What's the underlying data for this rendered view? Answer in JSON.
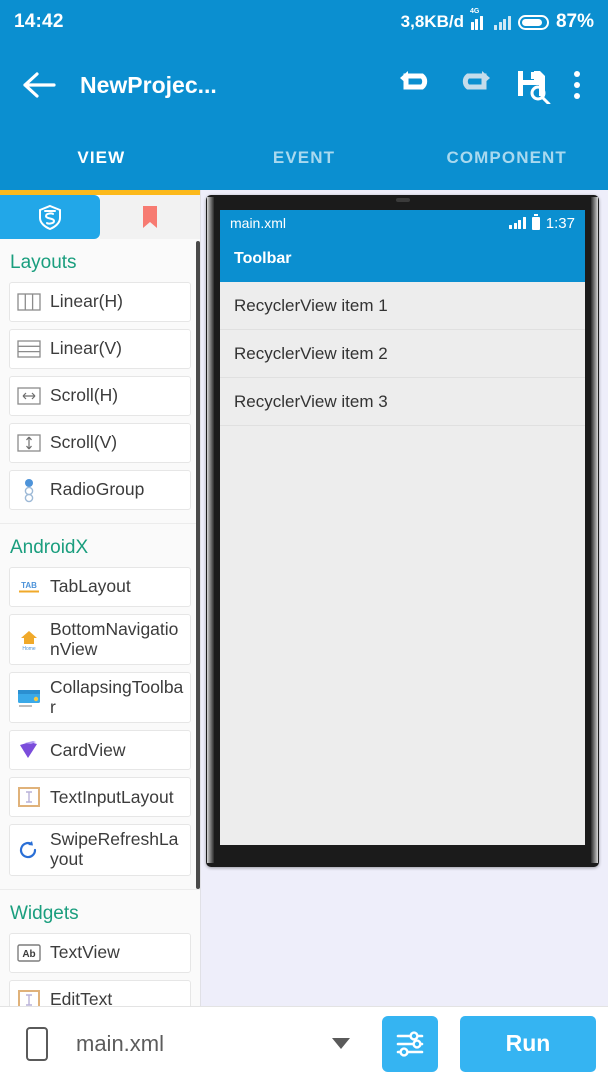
{
  "statusbar": {
    "clock": "14:42",
    "network_speed": "3,8KB/d",
    "network_type": "4G",
    "battery_percent": "87%"
  },
  "appbar": {
    "title": "NewProjec...",
    "back_icon": "arrow-left-icon",
    "undo_icon": "undo-icon",
    "redo_icon": "redo-icon",
    "save_icon": "save-floppy-icon",
    "overflow_icon": "more-vertical-icon"
  },
  "tabs": [
    {
      "label": "VIEW",
      "active": true
    },
    {
      "label": "EVENT",
      "active": false
    },
    {
      "label": "COMPONENT",
      "active": false
    }
  ],
  "sidebar": {
    "tab_icons": [
      "shield-s-icon",
      "bookmark-icon"
    ],
    "accent_indicator_color": "#fcb91c",
    "section_color": "#1a9e7e",
    "sections": [
      {
        "title": "Layouts",
        "items": [
          {
            "label": "Linear(H)",
            "icon": "linear-horizontal-icon"
          },
          {
            "label": "Linear(V)",
            "icon": "linear-vertical-icon"
          },
          {
            "label": "Scroll(H)",
            "icon": "scroll-horizontal-icon"
          },
          {
            "label": "Scroll(V)",
            "icon": "scroll-vertical-icon"
          },
          {
            "label": "RadioGroup",
            "icon": "radio-group-icon"
          }
        ]
      },
      {
        "title": "AndroidX",
        "items": [
          {
            "label": "TabLayout",
            "icon": "tab-layout-icon"
          },
          {
            "label": "BottomNavigationView",
            "icon": "bottom-navigation-icon"
          },
          {
            "label": "CollapsingToolbar",
            "icon": "collapsing-toolbar-icon"
          },
          {
            "label": "CardView",
            "icon": "card-view-icon"
          },
          {
            "label": "TextInputLayout",
            "icon": "text-input-layout-icon"
          },
          {
            "label": "SwipeRefreshLayout",
            "icon": "swipe-refresh-icon"
          }
        ]
      },
      {
        "title": "Widgets",
        "items": [
          {
            "label": "TextView",
            "icon": "text-view-icon"
          },
          {
            "label": "EditText",
            "icon": "edit-text-icon"
          }
        ]
      }
    ]
  },
  "preview": {
    "file_name": "main.xml",
    "status_time": "1:37",
    "toolbar_title": "Toolbar",
    "recycler_items": [
      "RecyclerView item 1",
      "RecyclerView item 2",
      "RecyclerView item 3"
    ]
  },
  "bottombar": {
    "device_icon": "phone-outline-icon",
    "file_name": "main.xml",
    "dropdown_icon": "chevron-down-icon",
    "settings_icon": "sliders-icon",
    "run_label": "Run",
    "accent_color": "#35b4f2"
  }
}
